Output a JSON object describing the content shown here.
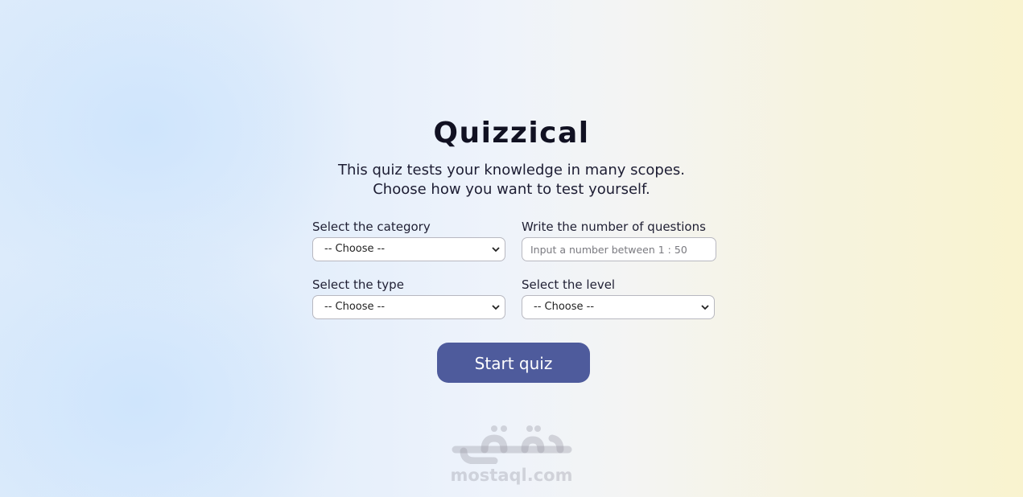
{
  "app": {
    "title": "Quizzical",
    "subtitle_line1": "This quiz tests your knowledge in many scopes.",
    "subtitle_line2": "Choose how you want to test yourself."
  },
  "form": {
    "category": {
      "label": "Select the category",
      "selected": "-- Choose --"
    },
    "number": {
      "label": "Write the number of questions",
      "value": "",
      "placeholder": "Input a number between 1 : 50"
    },
    "type": {
      "label": "Select the type",
      "selected": "-- Choose --"
    },
    "level": {
      "label": "Select the level",
      "selected": "-- Choose --"
    },
    "start_label": "Start quiz"
  },
  "watermark": {
    "text": "mostaql.com",
    "logo_text": "مستقل"
  },
  "colors": {
    "button": "#4e5b9c",
    "background_left": "#dcebfb",
    "background_right": "#f9f3cf"
  },
  "icons": {
    "dropdown": "chevron-down-icon"
  }
}
